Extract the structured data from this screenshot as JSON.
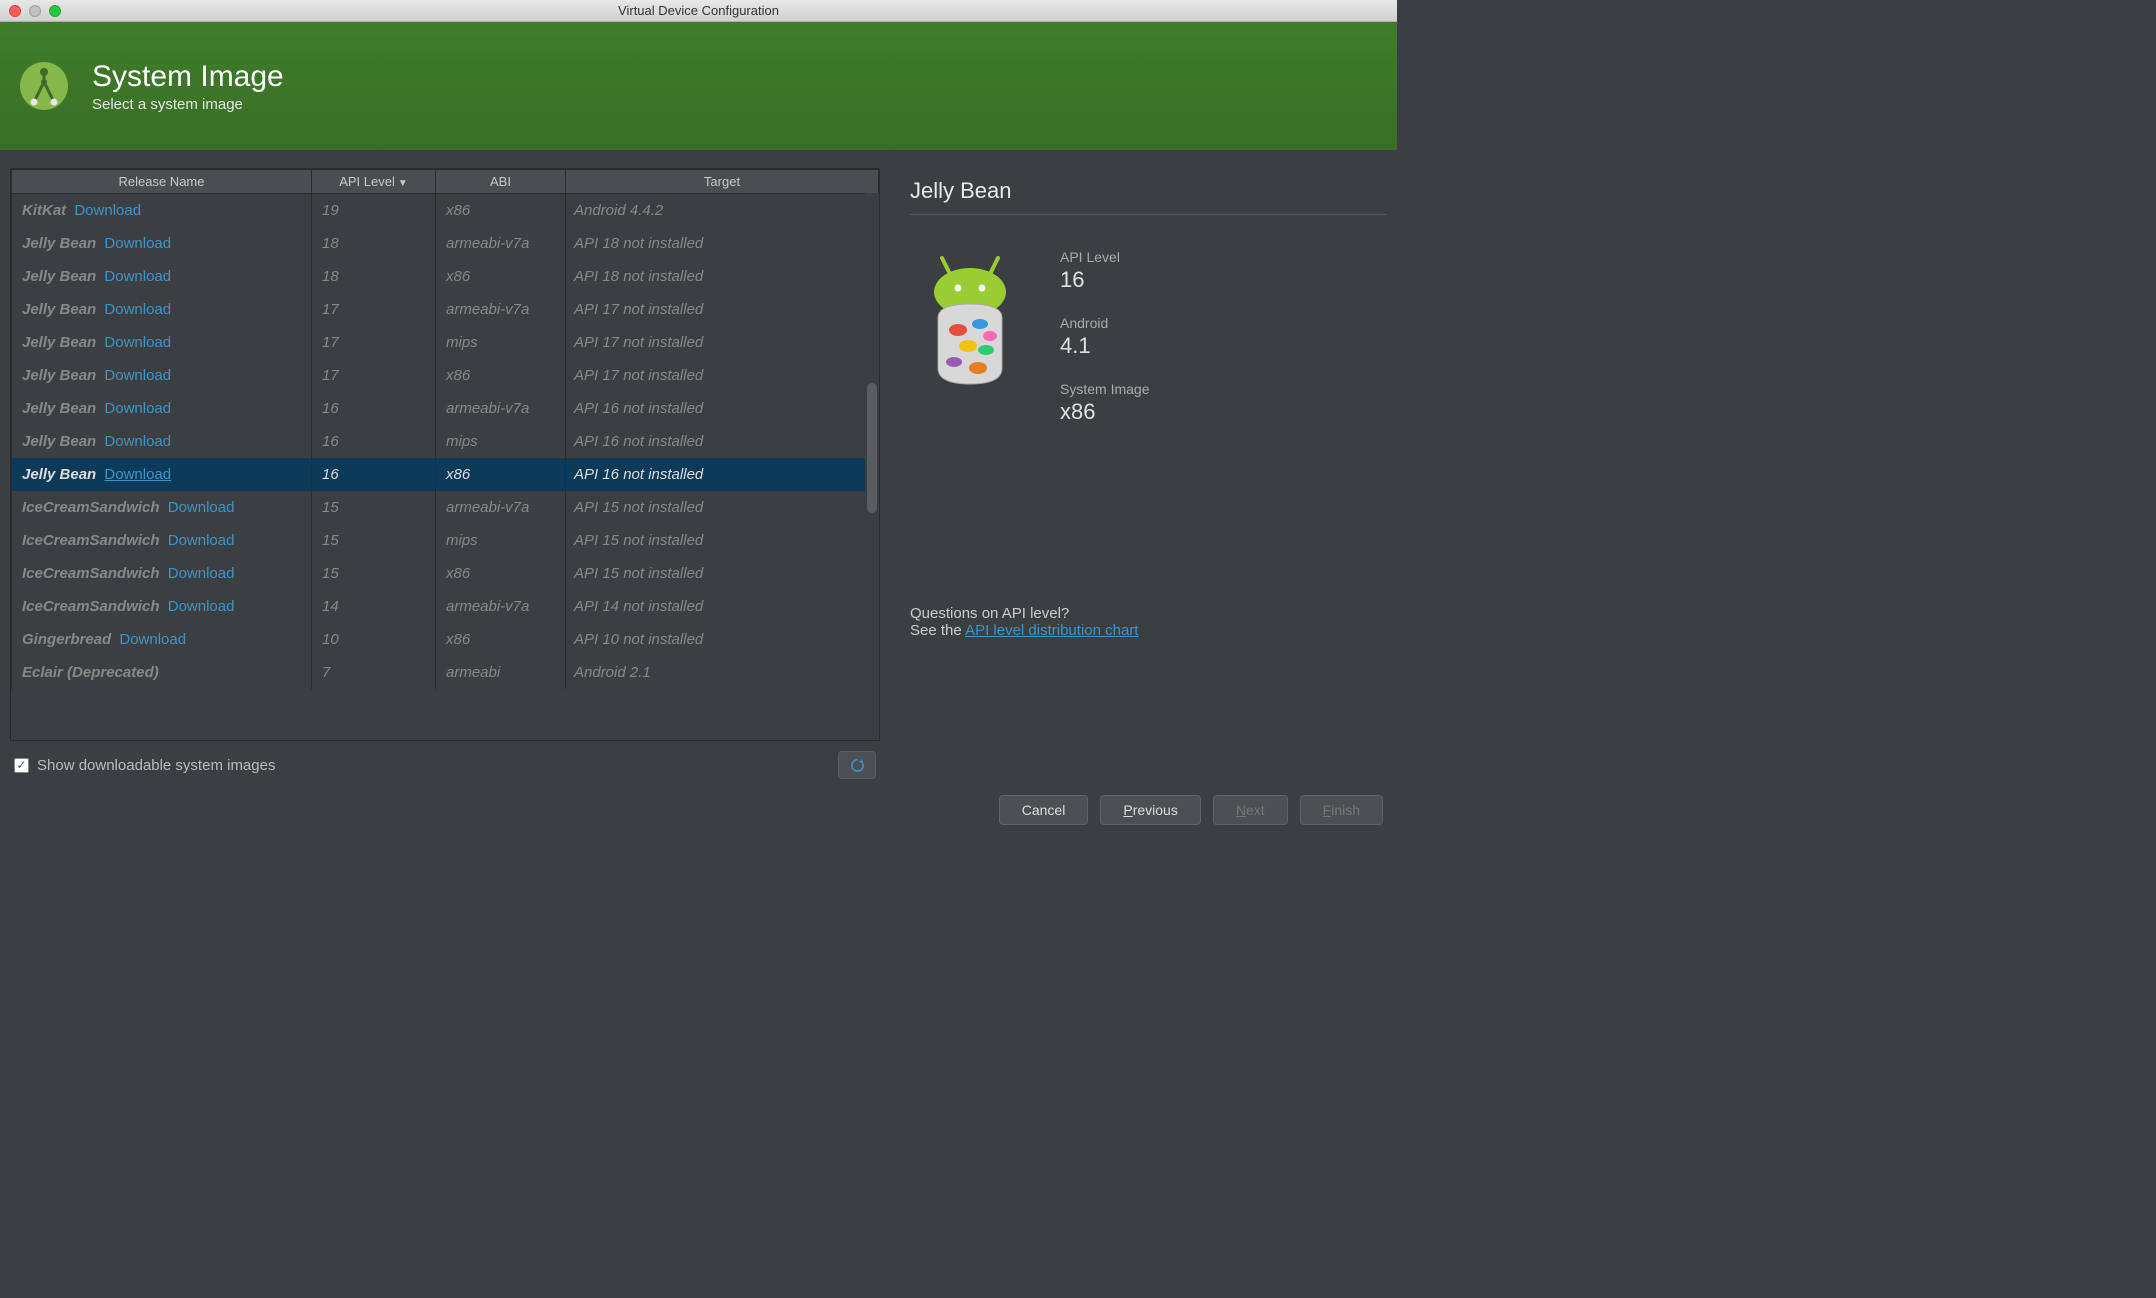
{
  "window": {
    "title": "Virtual Device Configuration"
  },
  "header": {
    "title": "System Image",
    "subtitle": "Select a system image"
  },
  "table": {
    "headers": {
      "release": "Release Name",
      "api": "API Level",
      "abi": "ABI",
      "target": "Target",
      "sort_indicator": "▼"
    },
    "download_label": "Download",
    "rows": [
      {
        "name": "KitKat",
        "api": "19",
        "abi": "x86",
        "target": "Android 4.4.2",
        "download": true
      },
      {
        "name": "Jelly Bean",
        "api": "18",
        "abi": "armeabi-v7a",
        "target": "API 18 not installed",
        "download": true
      },
      {
        "name": "Jelly Bean",
        "api": "18",
        "abi": "x86",
        "target": "API 18 not installed",
        "download": true
      },
      {
        "name": "Jelly Bean",
        "api": "17",
        "abi": "armeabi-v7a",
        "target": "API 17 not installed",
        "download": true
      },
      {
        "name": "Jelly Bean",
        "api": "17",
        "abi": "mips",
        "target": "API 17 not installed",
        "download": true
      },
      {
        "name": "Jelly Bean",
        "api": "17",
        "abi": "x86",
        "target": "API 17 not installed",
        "download": true
      },
      {
        "name": "Jelly Bean",
        "api": "16",
        "abi": "armeabi-v7a",
        "target": "API 16 not installed",
        "download": true
      },
      {
        "name": "Jelly Bean",
        "api": "16",
        "abi": "mips",
        "target": "API 16 not installed",
        "download": true
      },
      {
        "name": "Jelly Bean",
        "api": "16",
        "abi": "x86",
        "target": "API 16 not installed",
        "download": true,
        "selected": true
      },
      {
        "name": "IceCreamSandwich",
        "api": "15",
        "abi": "armeabi-v7a",
        "target": "API 15 not installed",
        "download": true
      },
      {
        "name": "IceCreamSandwich",
        "api": "15",
        "abi": "mips",
        "target": "API 15 not installed",
        "download": true
      },
      {
        "name": "IceCreamSandwich",
        "api": "15",
        "abi": "x86",
        "target": "API 15 not installed",
        "download": true
      },
      {
        "name": "IceCreamSandwich",
        "api": "14",
        "abi": "armeabi-v7a",
        "target": "API 14 not installed",
        "download": true
      },
      {
        "name": "Gingerbread",
        "api": "10",
        "abi": "x86",
        "target": "API 10 not installed",
        "download": true
      },
      {
        "name": "Eclair (Deprecated)",
        "api": "7",
        "abi": "armeabi",
        "target": "Android 2.1",
        "download": false
      }
    ]
  },
  "checkbox": {
    "label": "Show downloadable system images",
    "checked": true
  },
  "detail": {
    "title": "Jelly Bean",
    "api_label": "API Level",
    "api_value": "16",
    "android_label": "Android",
    "android_value": "4.1",
    "sysimg_label": "System Image",
    "sysimg_value": "x86"
  },
  "help": {
    "question": "Questions on API level?",
    "see_prefix": "See the ",
    "link_text": "API level distribution chart"
  },
  "buttons": {
    "cancel": "Cancel",
    "previous": "Previous",
    "next": "Next",
    "finish": "Finish"
  }
}
